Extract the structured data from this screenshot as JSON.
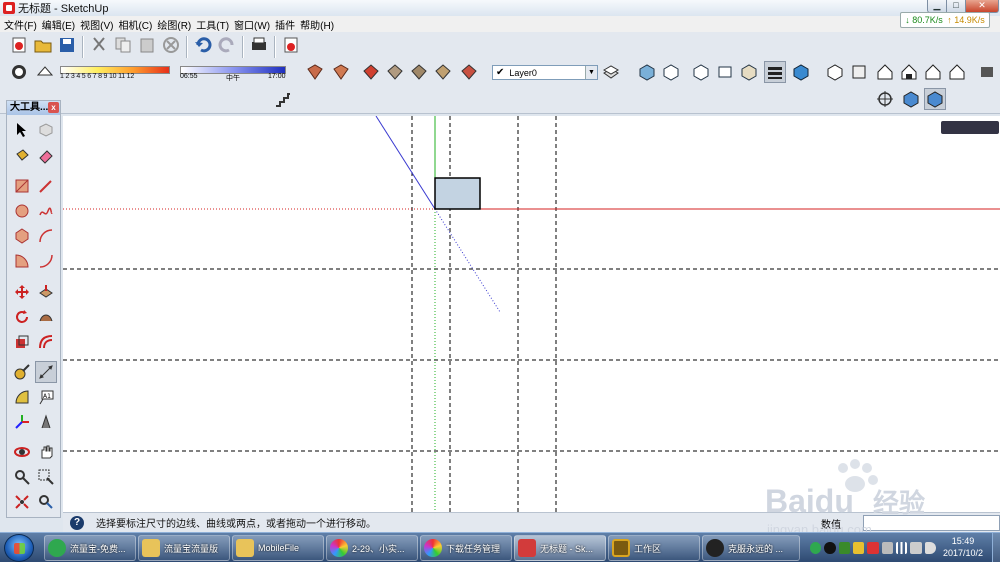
{
  "window": {
    "title": "无标题 - SketchUp",
    "minimize_glyph": "▁",
    "maximize_glyph": "□",
    "close_glyph": "✕"
  },
  "menu": [
    "文件(F)",
    "编辑(E)",
    "视图(V)",
    "相机(C)",
    "绘图(R)",
    "工具(T)",
    "窗口(W)",
    "插件",
    "帮助(H)"
  ],
  "net_speed": {
    "down": "80.7K/s",
    "up": "14.9K/s",
    "down_arrow": "↓",
    "up_arrow": "↑"
  },
  "shadow": {
    "months": "1  2  3  4  5  6  7  8  9  10 11 12",
    "time_start": "06:55",
    "time_mid": "中午",
    "time_end": "17:00"
  },
  "layer": {
    "check": "✔",
    "name": "Layer0",
    "dropdown_glyph": "▼"
  },
  "panel": {
    "title": "大工具...",
    "close_glyph": "x"
  },
  "status": {
    "help_glyph": "?",
    "text": "选择要标注尺寸的边线、曲线或两点，或者拖动一个进行移动。",
    "vcb_label": "数值"
  },
  "taskbar": {
    "tasks": [
      {
        "label": "流量宝-免费...",
        "color": "#2fa84f"
      },
      {
        "label": "流量宝流量版",
        "color": "#e8c35a"
      },
      {
        "label": "MobileFile",
        "color": "#e8c35a"
      },
      {
        "label": "2-29、小实...",
        "color": "#f0a030"
      },
      {
        "label": "下载任务管理",
        "color": "#f0a030"
      },
      {
        "label": "无标题 - Sk...",
        "color": "#d23b3b"
      },
      {
        "label": "工作区",
        "color": "#d9a520"
      },
      {
        "label": "克服永远的 ...",
        "color": "#222"
      }
    ],
    "time": "15:49",
    "date": "2017/10/2"
  },
  "watermark": {
    "brand": "Baidu",
    "cn": "经验",
    "url": "jingyan.baidu.com"
  },
  "colors": {
    "axis_red": "#d42020",
    "axis_green": "#22b022",
    "axis_blue": "#3a3ad0",
    "rect_fill": "#c3d3e2",
    "viewport_bg": "#ffffff"
  }
}
